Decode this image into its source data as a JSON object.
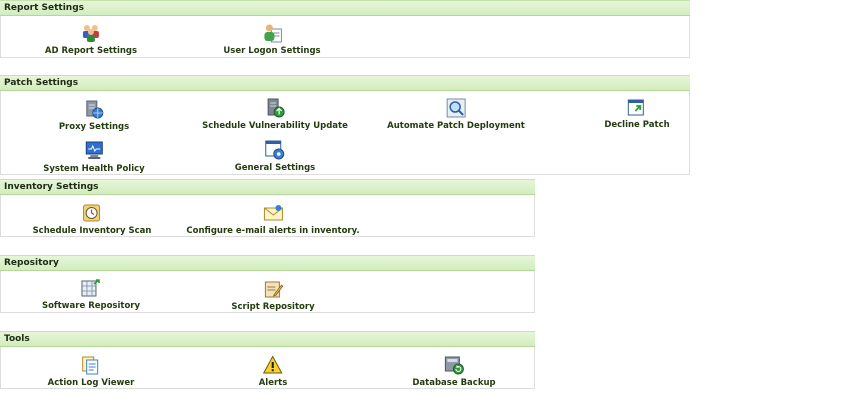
{
  "sections": {
    "report": {
      "title": "Report Settings",
      "items": [
        {
          "label": "AD Report Settings",
          "icon": "people-group-icon"
        },
        {
          "label": "User Logon Settings",
          "icon": "user-document-icon"
        }
      ]
    },
    "patch": {
      "title": "Patch Settings",
      "items": [
        {
          "label": "Proxy Settings",
          "icon": "server-globe-icon"
        },
        {
          "label": "Schedule Vulnerability Update",
          "icon": "server-update-icon"
        },
        {
          "label": "Automate Patch Deployment",
          "icon": "magnifier-icon"
        },
        {
          "label": "Decline Patch",
          "icon": "window-arrow-icon"
        },
        {
          "label": "System Health Policy",
          "icon": "monitor-health-icon"
        },
        {
          "label": "General Settings",
          "icon": "window-gear-icon"
        }
      ]
    },
    "inventory": {
      "title": "Inventory Settings",
      "items": [
        {
          "label": "Schedule Inventory Scan",
          "icon": "clock-scan-icon"
        },
        {
          "label": "Configure e-mail alerts in inventory.",
          "icon": "envelope-icon"
        }
      ]
    },
    "repository": {
      "title": "Repository",
      "items": [
        {
          "label": "Software Repository",
          "icon": "grid-arrow-icon"
        },
        {
          "label": "Script Repository",
          "icon": "script-pencil-icon"
        }
      ]
    },
    "tools": {
      "title": "Tools",
      "items": [
        {
          "label": "Action Log Viewer",
          "icon": "log-documents-icon"
        },
        {
          "label": "Alerts",
          "icon": "warning-icon"
        },
        {
          "label": "Database Backup",
          "icon": "database-backup-icon"
        }
      ]
    }
  }
}
